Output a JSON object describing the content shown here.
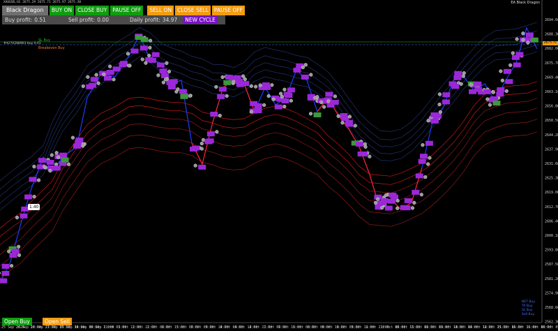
{
  "window": {
    "symbol_info": "XAUUSD,H1  2675.29 2675.71 2675.97 2675.30",
    "ea_label": "EA Black Dragon"
  },
  "panel": {
    "title": "Black Dragon",
    "buttons": [
      {
        "label": "BUY ON",
        "color": "#0f9d0f"
      },
      {
        "label": "CLOSE BUY",
        "color": "#0f9d0f"
      },
      {
        "label": "PAUSE OFF",
        "color": "#0f9d0f"
      },
      {
        "label": "SELL ON",
        "color": "#f39c12"
      },
      {
        "label": "CLOSE SELL",
        "color": "#f39c12"
      },
      {
        "label": "PAUSE OFF",
        "color": "#f39c12"
      }
    ],
    "buy_profit_label": "Buy profit:",
    "buy_profit_value": "0.51",
    "sell_profit_label": "Sell profit:",
    "sell_profit_value": "0.00",
    "daily_profit_label": "Daily profit:",
    "daily_profit_value": "34.97",
    "new_cycle_label": "NEW CYCLE"
  },
  "chart_labels": {
    "sl_buy": "SL Buy",
    "breakeven_buy": "Breakeven Buy",
    "order_info": "#4270288963 buy 0.01",
    "current_price": "2675.71",
    "price_bubble": "1.40"
  },
  "price_axis": [
    "2694.60",
    "2688.30",
    "2682.00",
    "2675.70",
    "2669.40",
    "2663.10",
    "2656.80",
    "2650.50",
    "2644.20",
    "2637.90",
    "2631.60",
    "2625.30",
    "2619.00",
    "2612.70",
    "2606.40",
    "2600.10",
    "2593.80",
    "2587.50",
    "2581.20",
    "2574.90",
    "2568.60",
    "2562.30"
  ],
  "time_axis": [
    "25 Sep 2024",
    "26 Sep 10:00",
    "26 Sep 23:00",
    "27 Sep 05:00",
    "27 Sep 14:00",
    "30 Sep 08:00",
    "30 Sep 21:00",
    "1 Oct 03:00",
    "1 Oct 12:00",
    "1 Oct 21:00",
    "2 Oct 06:00",
    "2 Oct 15:00",
    "3 Oct 00:00",
    "3 Oct 09:00",
    "3 Oct 18:00",
    "4 Oct 03:00",
    "4 Oct 12:00",
    "4 Oct 21:00",
    "7 Oct 06:00",
    "7 Oct 15:00",
    "8 Oct 00:00",
    "8 Oct 09:00",
    "8 Oct 18:00",
    "9 Oct 03:00",
    "9 Oct 12:00",
    "9 Oct 21:00",
    "10 Oct 06:00",
    "10 Oct 15:00",
    "11 Oct 00:00",
    "11 Oct 09:00",
    "11 Oct 18:00",
    "14 Oct 03:00",
    "14 Oct 12:00",
    "14 Oct 21:00",
    "15 Oct 06:00",
    "15 Oct 15:00",
    "16 Oct 00:00",
    "16 Oct 09:00"
  ],
  "legend": [
    "NET Buy",
    "TP Buy",
    "SL Buy",
    "Sell Buy"
  ],
  "bottom_buttons": {
    "open_buy": "Open Buy",
    "open_sell": "Open Sell"
  },
  "colors": {
    "buy_line": "#1c3cff",
    "sell_line": "#ff2020",
    "label_purple": "#9b28d8",
    "label_green": "#3a9a3a",
    "label_red": "#d83030",
    "upper_bands": "#2a3f8f",
    "lower_bands": "#8f1a1a"
  }
}
